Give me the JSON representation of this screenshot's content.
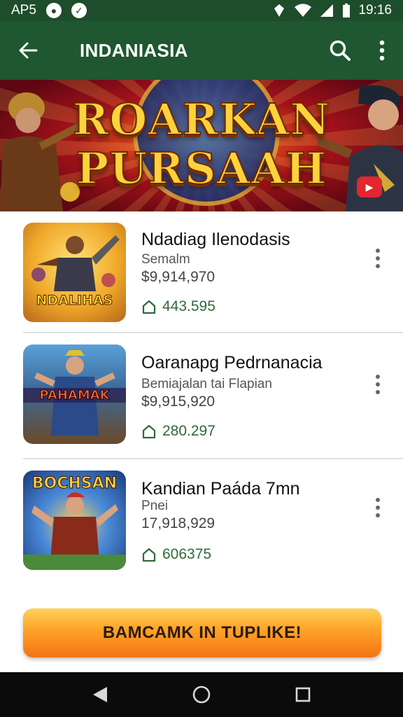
{
  "status_bar": {
    "left_text": "AP5",
    "time": "19:16"
  },
  "app_bar": {
    "title": "INDANIASIA"
  },
  "banner": {
    "line1": "ROARKAN",
    "line2": "PURSAAH"
  },
  "items": [
    {
      "name": "Ndadiag Ilenodasis",
      "subtitle": "Semalm",
      "price": "$9,914,970",
      "stat": "443.595",
      "thumb_label": "NDALIHAS"
    },
    {
      "name": "Oaranapg Pedrnanacia",
      "subtitle": "Bemiajalan tai Flapian",
      "price": "$9,915,920",
      "stat": "280.297",
      "thumb_label": "PAHAMAK"
    },
    {
      "name": "Kandian Paáda 7mn",
      "subtitle": "Pnei",
      "price": "17,918,929",
      "stat": "606375",
      "thumb_label": "BOCHSAN"
    }
  ],
  "cta": {
    "label": "BAMCAMK IN TUPLIKE!"
  },
  "colors": {
    "app_bar": "#1f5730",
    "status_bar": "#1e4d2b",
    "stat_green": "#2f6a3b",
    "cta_orange": "#f59a1e"
  }
}
